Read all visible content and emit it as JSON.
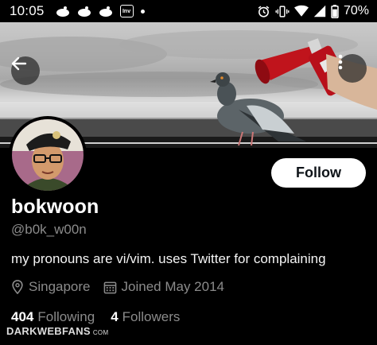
{
  "status_bar": {
    "time": "10:05",
    "app_badge": "Inv",
    "battery": "70%"
  },
  "profile": {
    "display_name": "bokwoon",
    "handle": "@b0k_w00n",
    "bio": "my pronouns are vi/vim.  uses Twitter for complaining",
    "location": "Singapore",
    "joined": "Joined May 2014",
    "following_count": "404",
    "following_label": "Following",
    "followers_count": "4",
    "followers_label": "Followers"
  },
  "actions": {
    "follow_label": "Follow",
    "back_icon": "arrow-left-icon",
    "more_icon": "more-vertical-icon"
  },
  "watermark": {
    "main": "DARKWEBFANS",
    "suffix": "COM"
  },
  "colors": {
    "background": "#000000",
    "secondary_text": "#8b8b8b",
    "button_bg": "#ffffff"
  }
}
